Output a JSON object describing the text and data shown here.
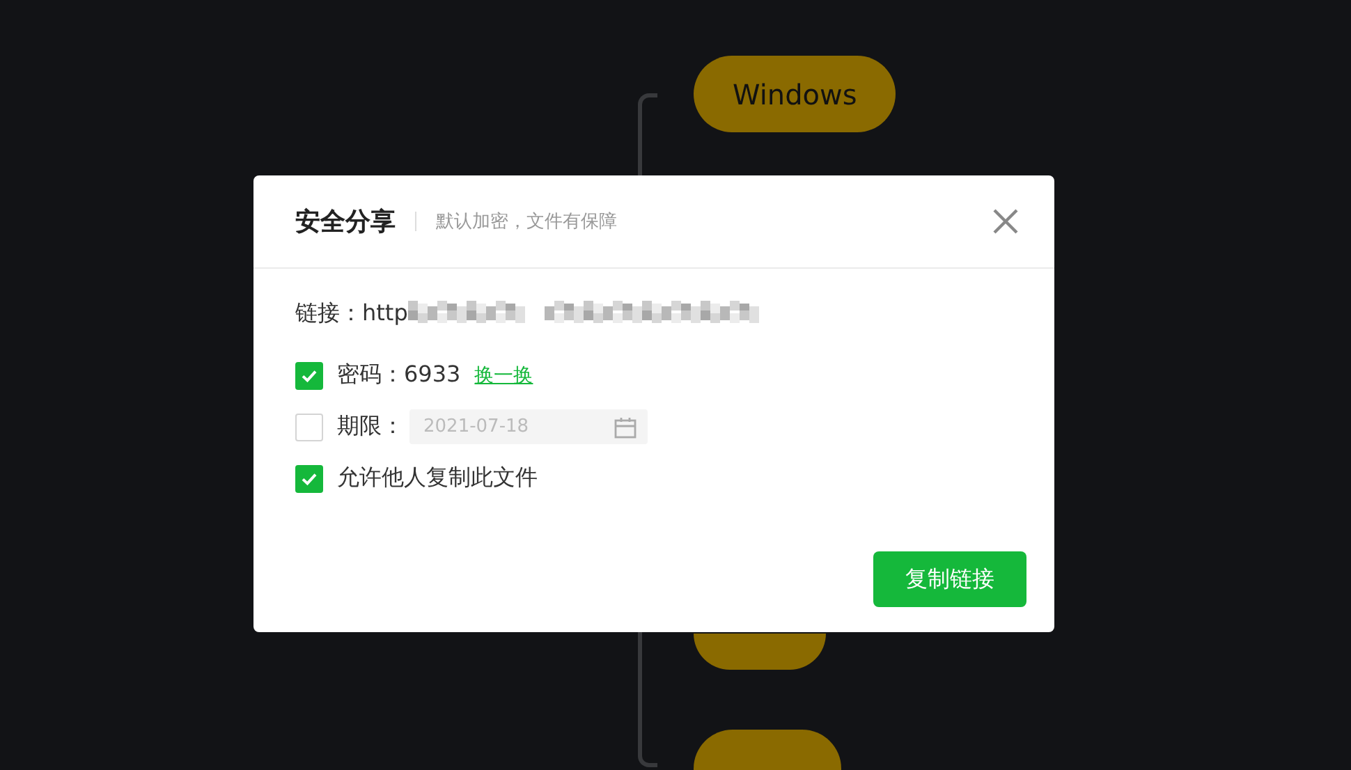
{
  "mind_map": {
    "nodes": [
      {
        "label": "Windows"
      },
      {
        "kind": "covered"
      },
      {
        "kind": "cut"
      }
    ]
  },
  "dialog": {
    "title": "安全分享",
    "subtitle": "默认加密，文件有保障",
    "link": {
      "label": "链接：http"
    },
    "options": [
      {
        "kind": "password",
        "checked": true,
        "label": "密码：6933",
        "action": "换一换"
      },
      {
        "kind": "expiry",
        "checked": false,
        "label": "期限：",
        "date": {
          "value": "2021-07-18",
          "disabled": true
        }
      },
      {
        "kind": "plain",
        "checked": true,
        "label": "允许他人复制此文件"
      }
    ],
    "button": "复制链接"
  }
}
